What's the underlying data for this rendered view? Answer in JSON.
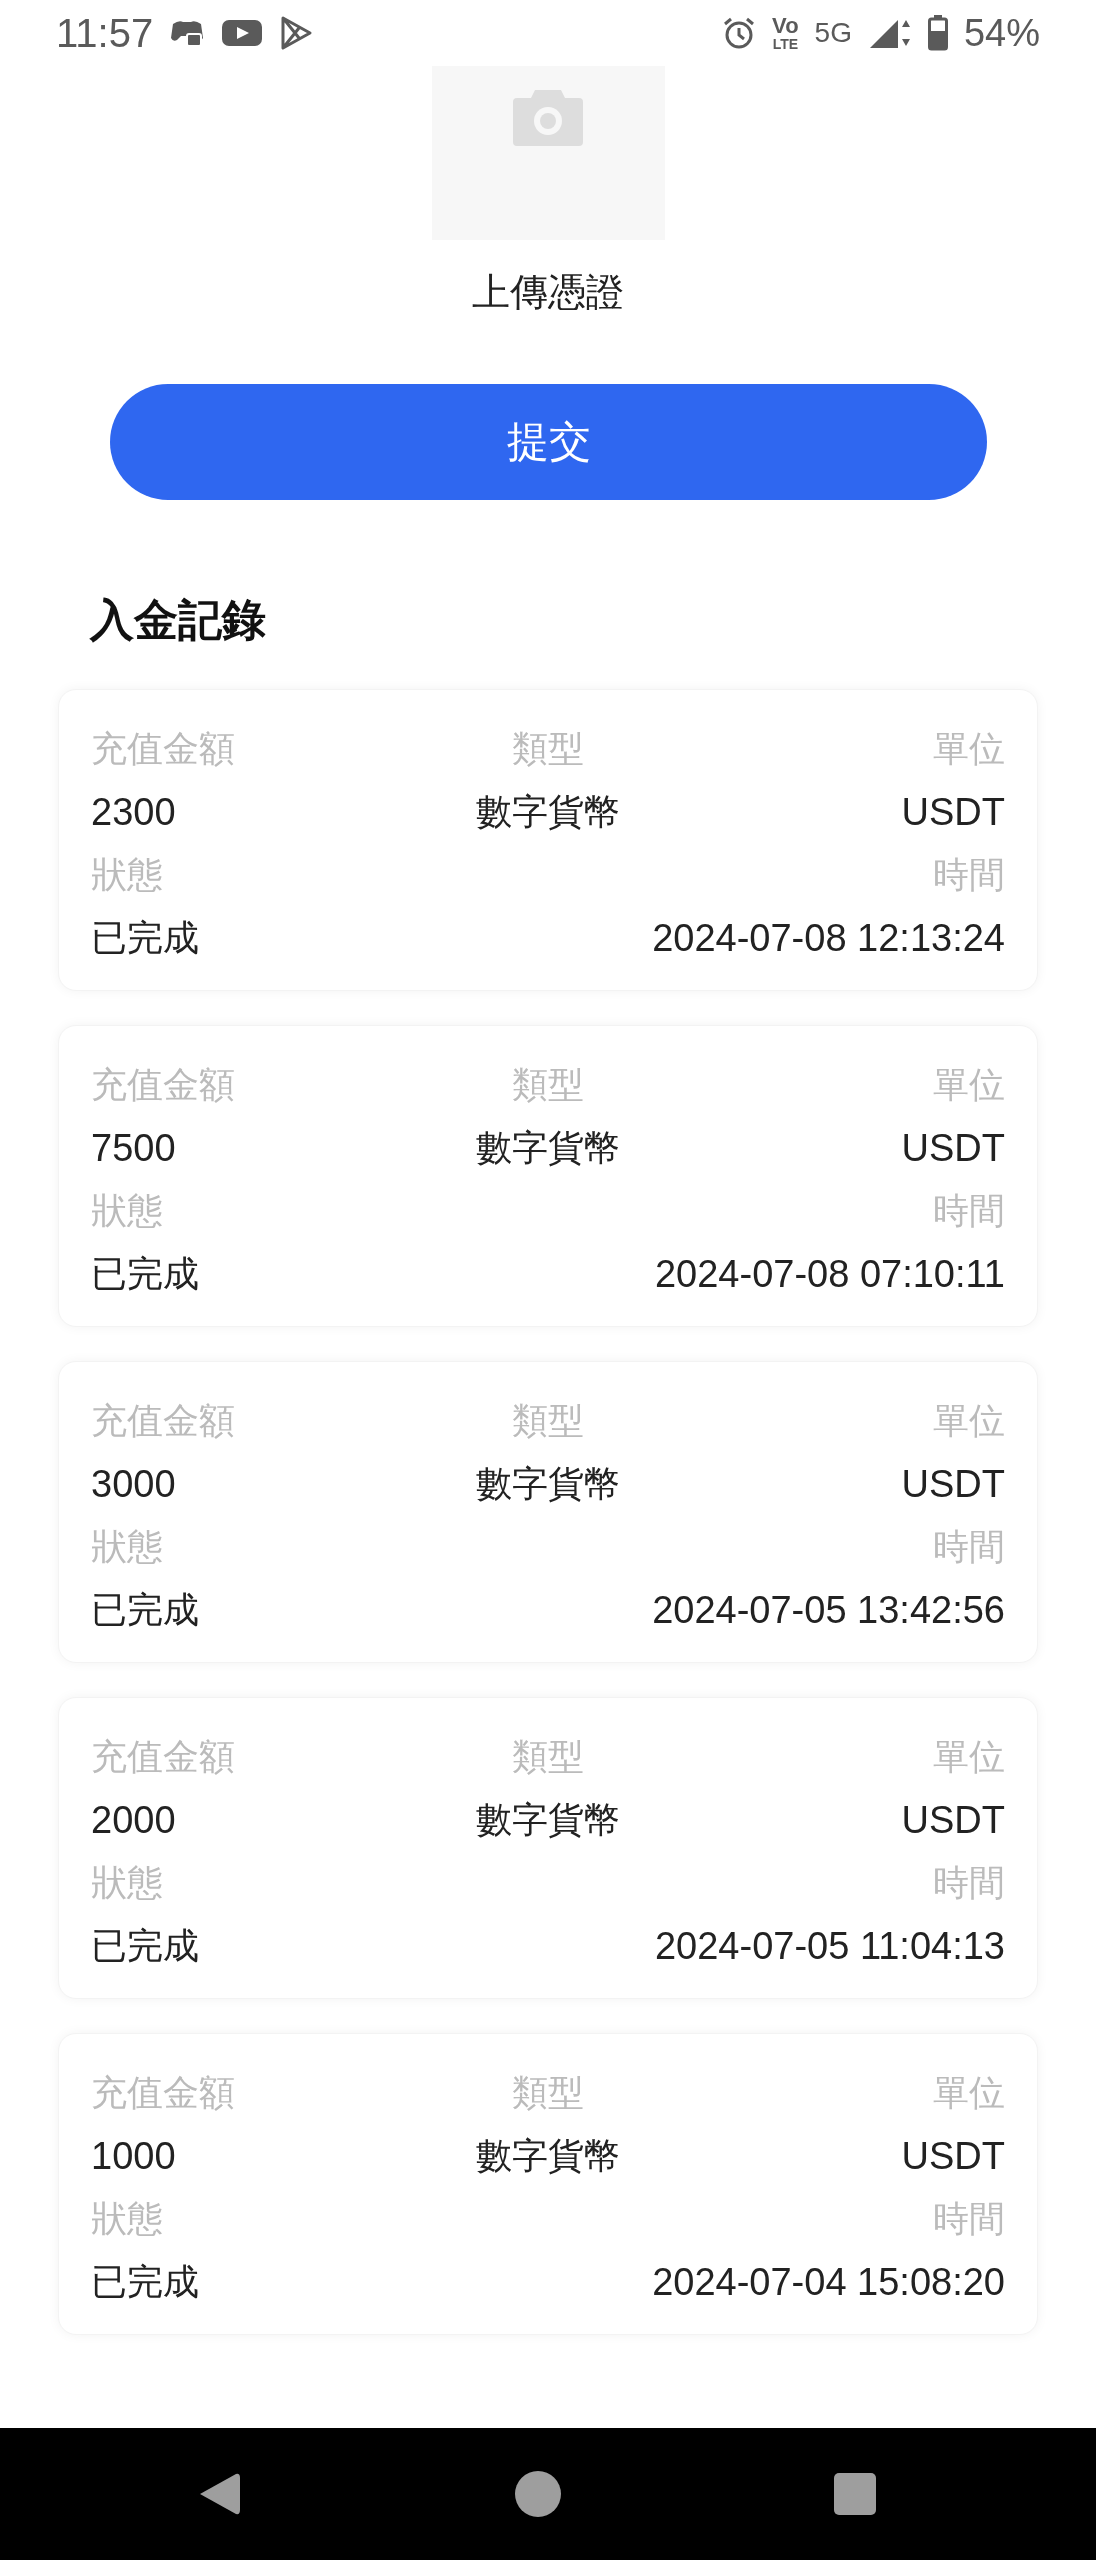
{
  "status_bar": {
    "time": "11:57",
    "volte": {
      "top": "Vo",
      "bottom": "LTE"
    },
    "network": "5G",
    "battery": "54%"
  },
  "upload": {
    "label": "上傳憑證"
  },
  "submit_button": "提交",
  "records": {
    "title": "入金記錄",
    "items": [
      {
        "amount_label": "充值金額",
        "type_label": "類型",
        "unit_label": "單位",
        "amount": "2300",
        "type": "數字貨幣",
        "unit": "USDT",
        "status_label": "狀態",
        "time_label": "時間",
        "status": "已完成",
        "time": "2024-07-08 12:13:24"
      },
      {
        "amount_label": "充值金額",
        "type_label": "類型",
        "unit_label": "單位",
        "amount": "7500",
        "type": "數字貨幣",
        "unit": "USDT",
        "status_label": "狀態",
        "time_label": "時間",
        "status": "已完成",
        "time": "2024-07-08 07:10:11"
      },
      {
        "amount_label": "充值金額",
        "type_label": "類型",
        "unit_label": "單位",
        "amount": "3000",
        "type": "數字貨幣",
        "unit": "USDT",
        "status_label": "狀態",
        "time_label": "時間",
        "status": "已完成",
        "time": "2024-07-05 13:42:56"
      },
      {
        "amount_label": "充值金額",
        "type_label": "類型",
        "unit_label": "單位",
        "amount": "2000",
        "type": "數字貨幣",
        "unit": "USDT",
        "status_label": "狀態",
        "time_label": "時間",
        "status": "已完成",
        "time": "2024-07-05 11:04:13"
      },
      {
        "amount_label": "充值金額",
        "type_label": "類型",
        "unit_label": "單位",
        "amount": "1000",
        "type": "數字貨幣",
        "unit": "USDT",
        "status_label": "狀態",
        "time_label": "時間",
        "status": "已完成",
        "time": "2024-07-04 15:08:20"
      }
    ]
  }
}
